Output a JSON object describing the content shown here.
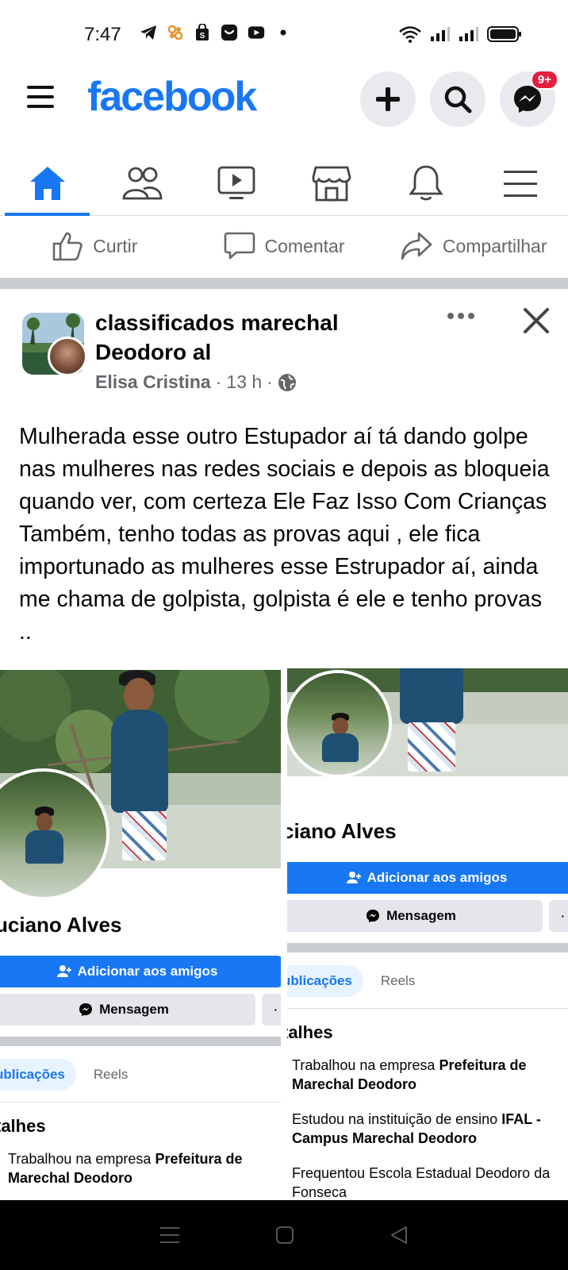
{
  "status_bar": {
    "time": "7:47",
    "left_icons": [
      "telegram-icon",
      "app-icon",
      "shopping-bag-icon",
      "alert-icon",
      "youtube-icon",
      "dot-icon"
    ],
    "right_icons": [
      "wifi-icon",
      "signal-icon",
      "signal-icon",
      "battery-icon"
    ]
  },
  "header": {
    "logo": "facebook",
    "messenger_badge": "9+"
  },
  "nav_tabs": [
    "home",
    "friends",
    "watch",
    "marketplace",
    "notifications",
    "menu"
  ],
  "actions": {
    "like": "Curtir",
    "comment": "Comentar",
    "share": "Compartilhar"
  },
  "post": {
    "group_name": "classificados marechal Deodoro al",
    "author": "Elisa Cristina",
    "time": "13 h",
    "sep": "·",
    "text": "Mulherada esse outro Estupador aí tá dando golpe nas mulheres nas redes sociais e depois as bloqueia quando ver,  com certeza Ele Faz Isso Com Crianças Também,  tenho todas as provas aqui , ele fica importunado as mulheres esse Estrupador aí, ainda me chama de golpista, golpista é ele e tenho provas .."
  },
  "screenshot_left": {
    "name": "uciano Alves",
    "add_friend": "Adicionar aos amigos",
    "message": "Mensagem",
    "tab_posts": "ublicações",
    "tab_reels": "Reels",
    "details_title": "talhes",
    "work_prefix": "Trabalhou na empresa ",
    "work_company": "Prefeitura de Marechal Deodoro"
  },
  "screenshot_right": {
    "name": "ciano Alves",
    "add_friend": "Adicionar aos amigos",
    "message": "Mensagem",
    "tab_posts": "ublicações",
    "tab_reels": "Reels",
    "details_title": "talhes",
    "work_prefix": "Trabalhou na empresa ",
    "work_company": "Prefeitura de Marechal Deodoro",
    "study_prefix": "Estudou na instituição de ensino ",
    "study_school": "IFAL - Campus Marechal Deodoro",
    "school_line": "Frequentou Escola Estadual Deodoro da Fonseca"
  }
}
